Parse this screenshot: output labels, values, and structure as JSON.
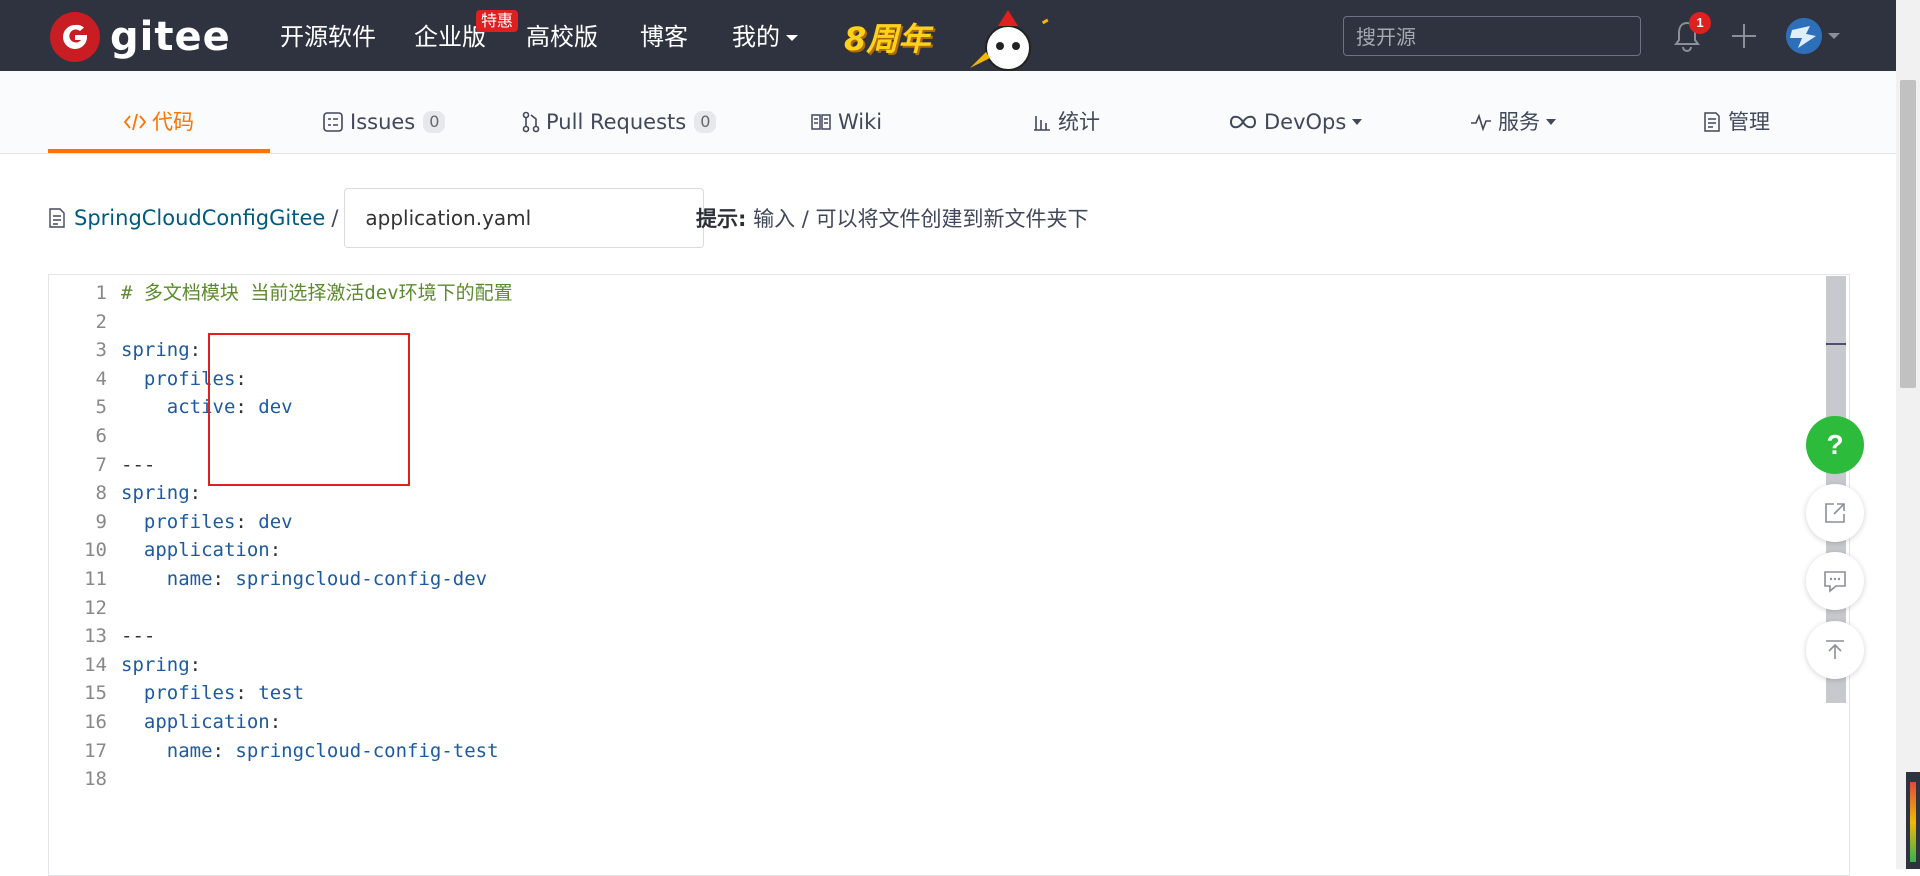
{
  "nav": {
    "logo_text": "gitee",
    "items": [
      "开源软件",
      "企业版",
      "高校版",
      "博客",
      "我的"
    ],
    "promo_badge": "特惠",
    "anniversary": "8周年",
    "search_placeholder": "搜开源",
    "notification_count": "1"
  },
  "tabs": [
    {
      "label": "代码",
      "active": true
    },
    {
      "label": "Issues",
      "count": "0"
    },
    {
      "label": "Pull Requests",
      "count": "0"
    },
    {
      "label": "Wiki"
    },
    {
      "label": "统计"
    },
    {
      "label": "DevOps"
    },
    {
      "label": "服务"
    },
    {
      "label": "管理"
    }
  ],
  "path": {
    "repo": "SpringCloudConfigGitee",
    "separator": "/",
    "filename": "application.yaml",
    "hint_label": "提示:",
    "hint_text": "输入 / 可以将文件创建到新文件夹下"
  },
  "editor": {
    "lines": [
      {
        "n": "1",
        "comment": "# 多文档模块 当前选择激活dev环境下的配置"
      },
      {
        "n": "2"
      },
      {
        "n": "3",
        "indent": "",
        "key": "spring",
        "sep": ":"
      },
      {
        "n": "4",
        "indent": "  ",
        "key": "profiles",
        "sep": ":"
      },
      {
        "n": "5",
        "indent": "    ",
        "key": "active",
        "sep": ": ",
        "val": "dev"
      },
      {
        "n": "6"
      },
      {
        "n": "7",
        "plain": "---"
      },
      {
        "n": "8",
        "indent": "",
        "key": "spring",
        "sep": ":"
      },
      {
        "n": "9",
        "indent": "  ",
        "key": "profiles",
        "sep": ": ",
        "val": "dev"
      },
      {
        "n": "10",
        "indent": "  ",
        "key": "application",
        "sep": ":"
      },
      {
        "n": "11",
        "indent": "    ",
        "key": "name",
        "sep": ": ",
        "val": "springcloud-config-dev"
      },
      {
        "n": "12"
      },
      {
        "n": "13",
        "plain": "---"
      },
      {
        "n": "14",
        "indent": "",
        "key": "spring",
        "sep": ":"
      },
      {
        "n": "15",
        "indent": "  ",
        "key": "profiles",
        "sep": ": ",
        "val": "test"
      },
      {
        "n": "16",
        "indent": "  ",
        "key": "application",
        "sep": ":"
      },
      {
        "n": "17",
        "indent": "    ",
        "key": "name",
        "sep": ": ",
        "val": "springcloud-config-test"
      },
      {
        "n": "18"
      }
    ]
  },
  "fab": {
    "help": "?"
  },
  "colors": {
    "nav_bg": "#2e333f",
    "accent": "#fe7300",
    "brand_red": "#c71d23",
    "help_green": "#2dbb3c",
    "highlight_box": "#e02020"
  }
}
